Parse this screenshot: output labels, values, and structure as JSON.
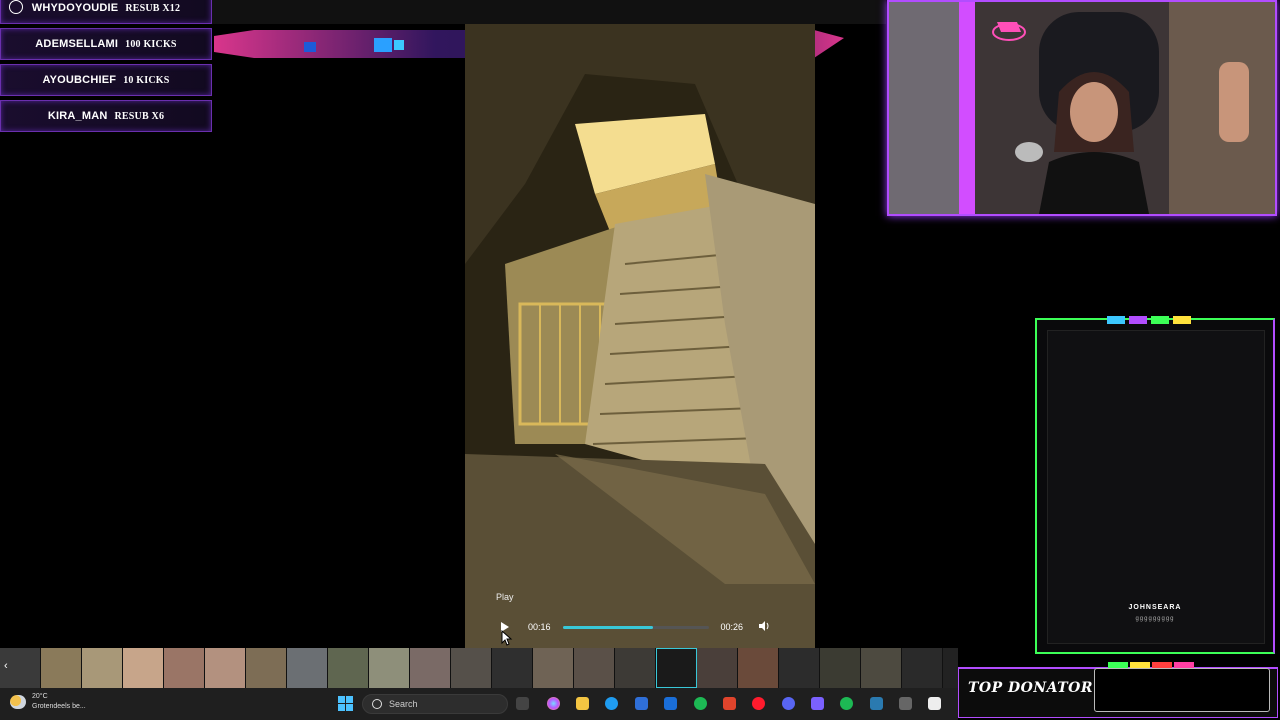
{
  "events": [
    {
      "name": "WHYDOYOUDIE",
      "kind": "RESUB X12"
    },
    {
      "name": "ADEMSELLAMI",
      "kind": "100 KICKS"
    },
    {
      "name": "AYOUBCHIEF",
      "kind": "10 KICKS"
    },
    {
      "name": "KIRA_MAN",
      "kind": "RESUB X6"
    }
  ],
  "player": {
    "tooltip": "Play",
    "current_time": "00:16",
    "duration": "00:26",
    "progress_fraction": 0.62
  },
  "donation": {
    "donor_name": "JOHNSEARA",
    "donor_sub": "ggggggggg"
  },
  "top_donator": {
    "label": "TOP DONATOR"
  },
  "weather": {
    "temp": "20°C",
    "desc": "Grotendeels be..."
  },
  "taskbar": {
    "search_placeholder": "Search"
  },
  "colors": {
    "accent_purple": "#b24dff",
    "accent_green": "#3cff57",
    "seek_fill": "#39c8d8",
    "pink": "#ff3fa4"
  }
}
